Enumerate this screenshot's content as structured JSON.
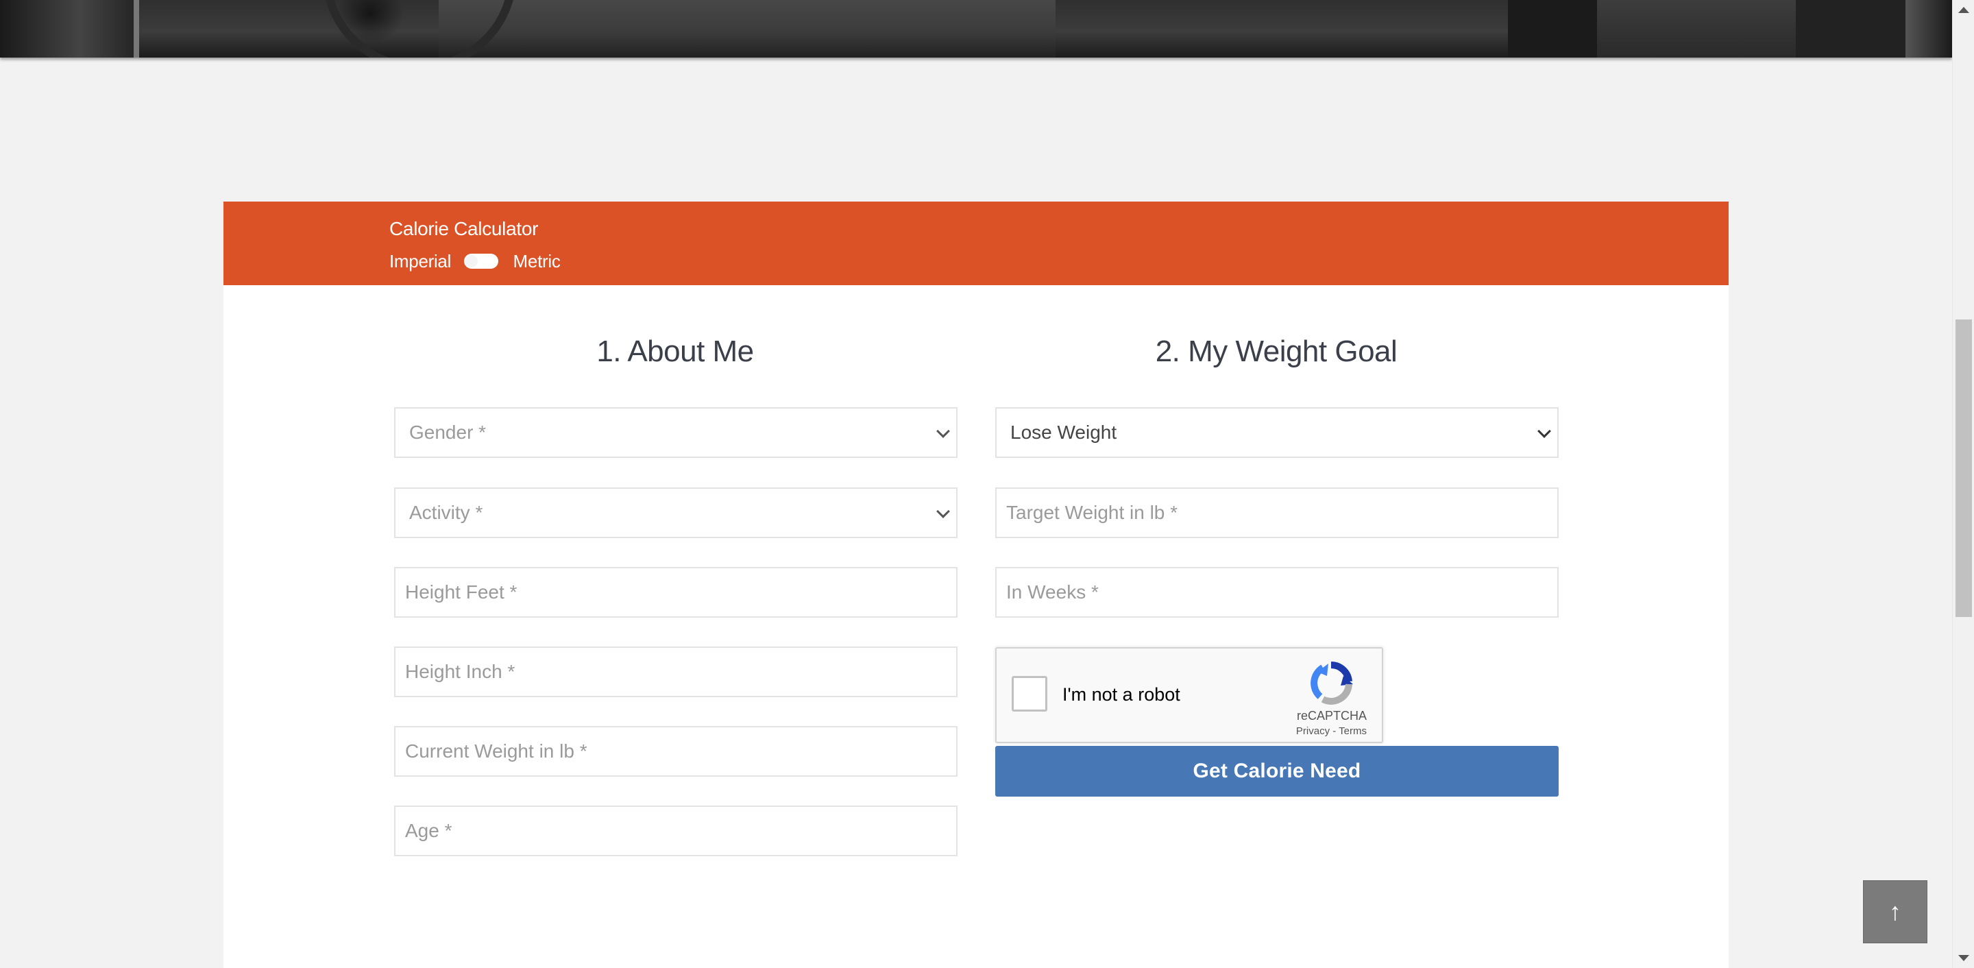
{
  "calculator": {
    "title": "Calorie Calculator",
    "unit_left": "Imperial",
    "unit_right": "Metric"
  },
  "about_me": {
    "heading": "1. About Me",
    "gender_placeholder": "Gender *",
    "activity_placeholder": "Activity *",
    "height_feet_placeholder": "Height Feet *",
    "height_inch_placeholder": "Height Inch *",
    "current_weight_placeholder": "Current Weight in lb *",
    "age_placeholder": "Age *"
  },
  "weight_goal": {
    "heading": "2. My Weight Goal",
    "goal_value": "Lose Weight",
    "target_weight_placeholder": "Target Weight in lb *",
    "weeks_placeholder": "In Weeks *"
  },
  "recaptcha": {
    "label": "I'm not a robot",
    "brand": "reCAPTCHA",
    "links": "Privacy - Terms"
  },
  "submit_label": "Get Calorie Need",
  "back_to_top_icon": "arrow-up-icon",
  "colors": {
    "header_accent": "#db5226",
    "button_blue": "#4877b5",
    "page_bg": "#f2f2f2"
  }
}
